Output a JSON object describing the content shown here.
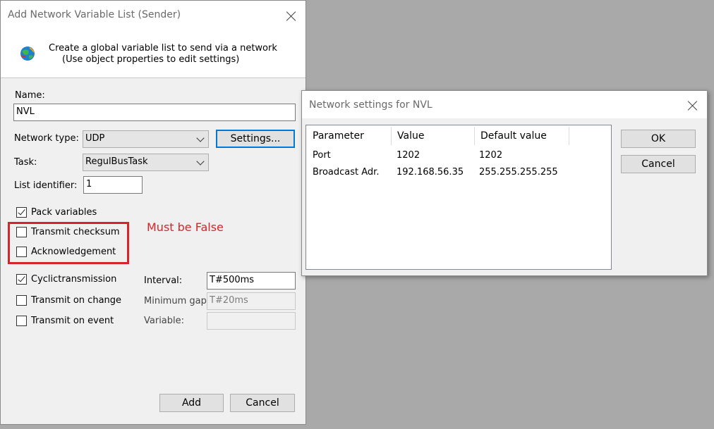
{
  "add_dialog": {
    "title": "Add Network Variable List (Sender)",
    "header_line1": "Create a global variable list to send via a network",
    "header_line2": "(Use object properties to edit settings)",
    "name_label": "Name:",
    "name_value": "NVL",
    "network_type_label": "Network type:",
    "network_type_value": "UDP",
    "settings_button": "Settings...",
    "task_label": "Task:",
    "task_value": "RegulBusTask",
    "list_identifier_label": "List identifier:",
    "list_identifier_value": "1",
    "checkboxes": {
      "pack_variables": {
        "label": "Pack variables",
        "checked": true
      },
      "transmit_checksum": {
        "label": "Transmit checksum",
        "checked": false
      },
      "acknowledgement": {
        "label": "Acknowledgement",
        "checked": false
      },
      "cyclic_transmission": {
        "label": "Cyclictransmission",
        "checked": true
      },
      "transmit_on_change": {
        "label": "Transmit on change",
        "checked": false
      },
      "transmit_on_event": {
        "label": "Transmit on event",
        "checked": false
      }
    },
    "interval_label": "Interval:",
    "interval_value": "T#500ms",
    "min_gap_label": "Minimum gap:",
    "min_gap_value": "T#20ms",
    "variable_label": "Variable:",
    "variable_value": "",
    "add_button": "Add",
    "cancel_button": "Cancel"
  },
  "annotation": {
    "text": "Must be False",
    "color": "#d8232a"
  },
  "settings_dialog": {
    "title": "Network settings for NVL",
    "columns": [
      "Parameter",
      "Value",
      "Default value"
    ],
    "rows": [
      {
        "parameter": "Port",
        "value": "1202",
        "default": "1202"
      },
      {
        "parameter": "Broadcast Adr.",
        "value": "192.168.56.35",
        "default": "255.255.255.255"
      }
    ],
    "ok_button": "OK",
    "cancel_button": "Cancel"
  },
  "colors": {
    "desktop": "#a9a9a9",
    "dialog_bg": "#f0f0f0",
    "focus_blue": "#0078d7"
  }
}
